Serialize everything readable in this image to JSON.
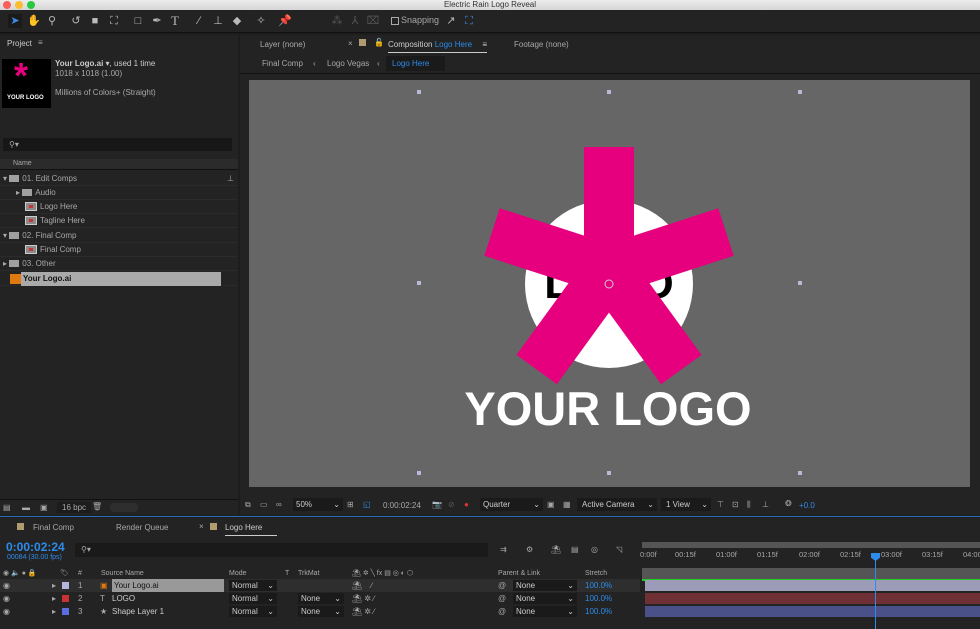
{
  "window": {
    "title": "Electric Rain Logo Reveal"
  },
  "toolbar": {
    "snapping_label": "Snapping",
    "tools": [
      "selection-tool",
      "hand-tool",
      "zoom-tool",
      "rotate-tool",
      "camera-tool",
      "pan-behind-tool",
      "rectangle-tool",
      "pen-tool",
      "type-tool",
      "brush-tool",
      "clone-stamp-tool",
      "eraser-tool",
      "roto-brush-tool",
      "puppet-pin-tool"
    ]
  },
  "project": {
    "title": "Project",
    "selected_name": "Your Logo.ai",
    "usage": ", used 1 time",
    "dimensions": "1018 x 1018 (1.00)",
    "colors": "Millions of Colors+ (Straight)",
    "thumb_label": "YOUR LOGO",
    "search_placeholder": "",
    "column_name": "Name",
    "bpc": "16 bpc",
    "items": [
      {
        "label": "01. Edit Comps",
        "type": "folder",
        "expanded": true
      },
      {
        "label": "Audio",
        "type": "folder",
        "expanded": false
      },
      {
        "label": "Logo Here",
        "type": "comp"
      },
      {
        "label": "Tagline Here",
        "type": "comp"
      },
      {
        "label": "02. Final Comp",
        "type": "folder",
        "expanded": true
      },
      {
        "label": "Final Comp",
        "type": "comp"
      },
      {
        "label": "03. Other",
        "type": "folder",
        "expanded": false
      },
      {
        "label": "Your Logo.ai",
        "type": "ai-file",
        "selected": true
      }
    ]
  },
  "viewer": {
    "tab_layer": "Layer (none)",
    "tab_comp_prefix": "Composition",
    "tab_comp_name": "Logo Here",
    "tab_footage": "Footage (none)",
    "breadcrumbs": [
      "Final Comp",
      "Logo Vegas",
      "Logo Here"
    ],
    "logo_text": "YOUR LOGO",
    "inner_text": "LOGO",
    "zoom": "50%",
    "timecode": "0:00:02:24",
    "resolution": "Quarter",
    "camera": "Active Camera",
    "views": "1 View",
    "exposure": "+0.0",
    "colors": {
      "background": "#666666",
      "asterisk": "#e6007e",
      "circle": "#ffffff"
    }
  },
  "timeline": {
    "tabs": [
      "Final Comp",
      "Render Queue",
      "Logo Here"
    ],
    "timecode": "0:00:02:24",
    "frame_info": "00084 (30.00 fps)",
    "columns": {
      "num": "#",
      "source": "Source Name",
      "mode": "Mode",
      "t": "T",
      "trkmat": "TrkMat",
      "parent": "Parent & Link",
      "stretch": "Stretch"
    },
    "layers": [
      {
        "num": "1",
        "name": "Your Logo.ai",
        "mode": "Normal",
        "trkmat": "",
        "parent": "None",
        "stretch": "100.0%",
        "color": "#b4b4e0",
        "bar": "#9c9cb8",
        "icon": "ai"
      },
      {
        "num": "2",
        "name": "LOGO",
        "mode": "Normal",
        "trkmat": "None",
        "parent": "None",
        "stretch": "100.0%",
        "color": "#c83232",
        "bar": "#6e3034",
        "icon": "T"
      },
      {
        "num": "3",
        "name": "Shape Layer 1",
        "mode": "Normal",
        "trkmat": "None",
        "parent": "None",
        "stretch": "100.0%",
        "color": "#5a6ee0",
        "bar": "#4a5088",
        "icon": "★"
      }
    ],
    "ruler": [
      "0:00f",
      "00:15f",
      "01:00f",
      "01:15f",
      "02:00f",
      "02:15f",
      "03:00f",
      "03:15f",
      "04:00"
    ]
  }
}
